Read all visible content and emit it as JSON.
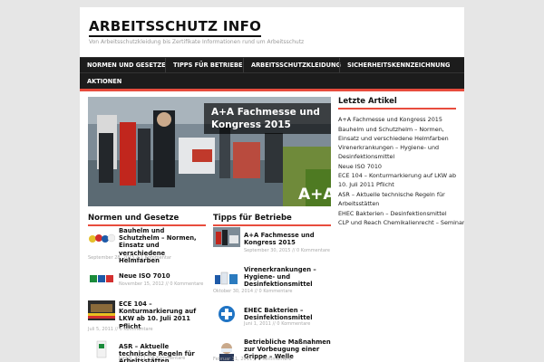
{
  "site": {
    "title": "ARBEITSSCHUTZ INFO",
    "description": "Von Arbeitsschutzkleidung bis Zertifikate Informationen rund um Arbeitsschutz"
  },
  "nav": {
    "items": [
      "NORMEN UND GESETZE",
      "TIPPS FÜR BETRIEBE",
      "ARBEITSSCHUTZKLEIDUNG",
      "SICHERHEITSKENNZEICHNUNG",
      "AKTIONEN"
    ]
  },
  "featured": {
    "title": "A+A Fachmesse und Kongress 2015",
    "logo_text": "A+A"
  },
  "sections": {
    "left": {
      "heading": "Normen und Gesetze",
      "posts": [
        {
          "title": "Bauhelm und Schutzhelm – Normen, Einsatz und verschiedene Helmfarben",
          "meta": "September 28, 2015 // 1 Kommentar"
        },
        {
          "title": "Neue ISO 7010",
          "meta": "November 15, 2012 // 0 Kommentare"
        },
        {
          "title": "ECE 104 – Konturmarkierung auf LKW ab 10. Juli 2011 Pflicht",
          "meta": "Juli 5, 2011 // 0 Kommentare"
        },
        {
          "title": "ASR – Aktuelle technische Regeln für Arbeitsstätten",
          "meta": "Juni 9, 2011 // 0 Kommentare"
        }
      ]
    },
    "right": {
      "heading": "Tipps für Betriebe",
      "posts": [
        {
          "title": "A+A Fachmesse und Kongress 2015",
          "meta": "September 30, 2015 // 0 Kommentare"
        },
        {
          "title": "Virenerkrankungen – Hygiene- und Desinfektionsmittel",
          "meta": "Oktober 30, 2014 // 0 Kommentare"
        },
        {
          "title": "EHEC Bakterien – Desinfektionsmittel",
          "meta": "Juni 1, 2011 // 0 Kommentare"
        },
        {
          "title": "Betriebliche Maßnahmen zur Vorbeugung einer Grippe – Welle",
          "meta": "Februar 11, 2011 // 0 Kommentare"
        }
      ]
    }
  },
  "sidebar": {
    "heading": "Letzte Artikel",
    "lines": [
      "A+A Fachmesse und Kongress 2015",
      "Bauhelm und Schutzhelm – Normen,",
      "Einsatz und verschiedene Helmfarben",
      "Virenerkrankungen – Hygiene- und",
      "Desinfektionsmittel",
      "Neue ISO 7010",
      "ECE 104 – Konturmarkierung auf LKW ab",
      "10. Juli 2011 Pflicht",
      "ASR – Aktuelle technische Regeln für",
      "Arbeitsstätten",
      "EHEC Bakterien – Desinfektionsmittel",
      "CLP und Reach Chemikalienrecht – Seminar"
    ]
  },
  "colors": {
    "accent": "#e84c3d",
    "nav_bg": "#1c1c1c",
    "page_bg": "#e6e6e6"
  }
}
